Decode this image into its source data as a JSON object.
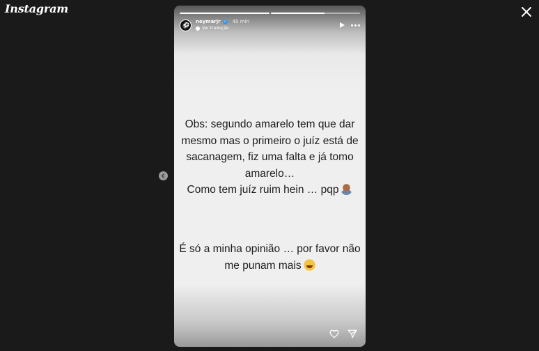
{
  "app": {
    "logo": "Instagram"
  },
  "story": {
    "progress": [
      1,
      0.6
    ],
    "username": "neymarjr",
    "time": "40 min",
    "avatar_text": "⚽",
    "translation_label": "Ver tradução",
    "text_block1": [
      "Obs: segundo amarelo tem que dar",
      "mesmo mas o primeiro o juíz está de",
      "sacanagem, fiz uma falta e já tomo",
      "amarelo…",
      "Como tem juíz ruim hein … pqp"
    ],
    "text_block2": [
      "É só a minha opinião … por favor não",
      "me punam mais"
    ]
  },
  "icons": {
    "close": "close-icon",
    "prev": "chevron-left-icon",
    "play": "play-icon",
    "more": "more-options-icon",
    "heart": "heart-icon",
    "send": "send-icon",
    "verified": "verified-badge-icon",
    "globe": "globe-icon"
  },
  "colors": {
    "background": "#1a1a1a",
    "story_bg": "#efefef",
    "verified": "#3897f0",
    "text": "#1c1c1c"
  }
}
